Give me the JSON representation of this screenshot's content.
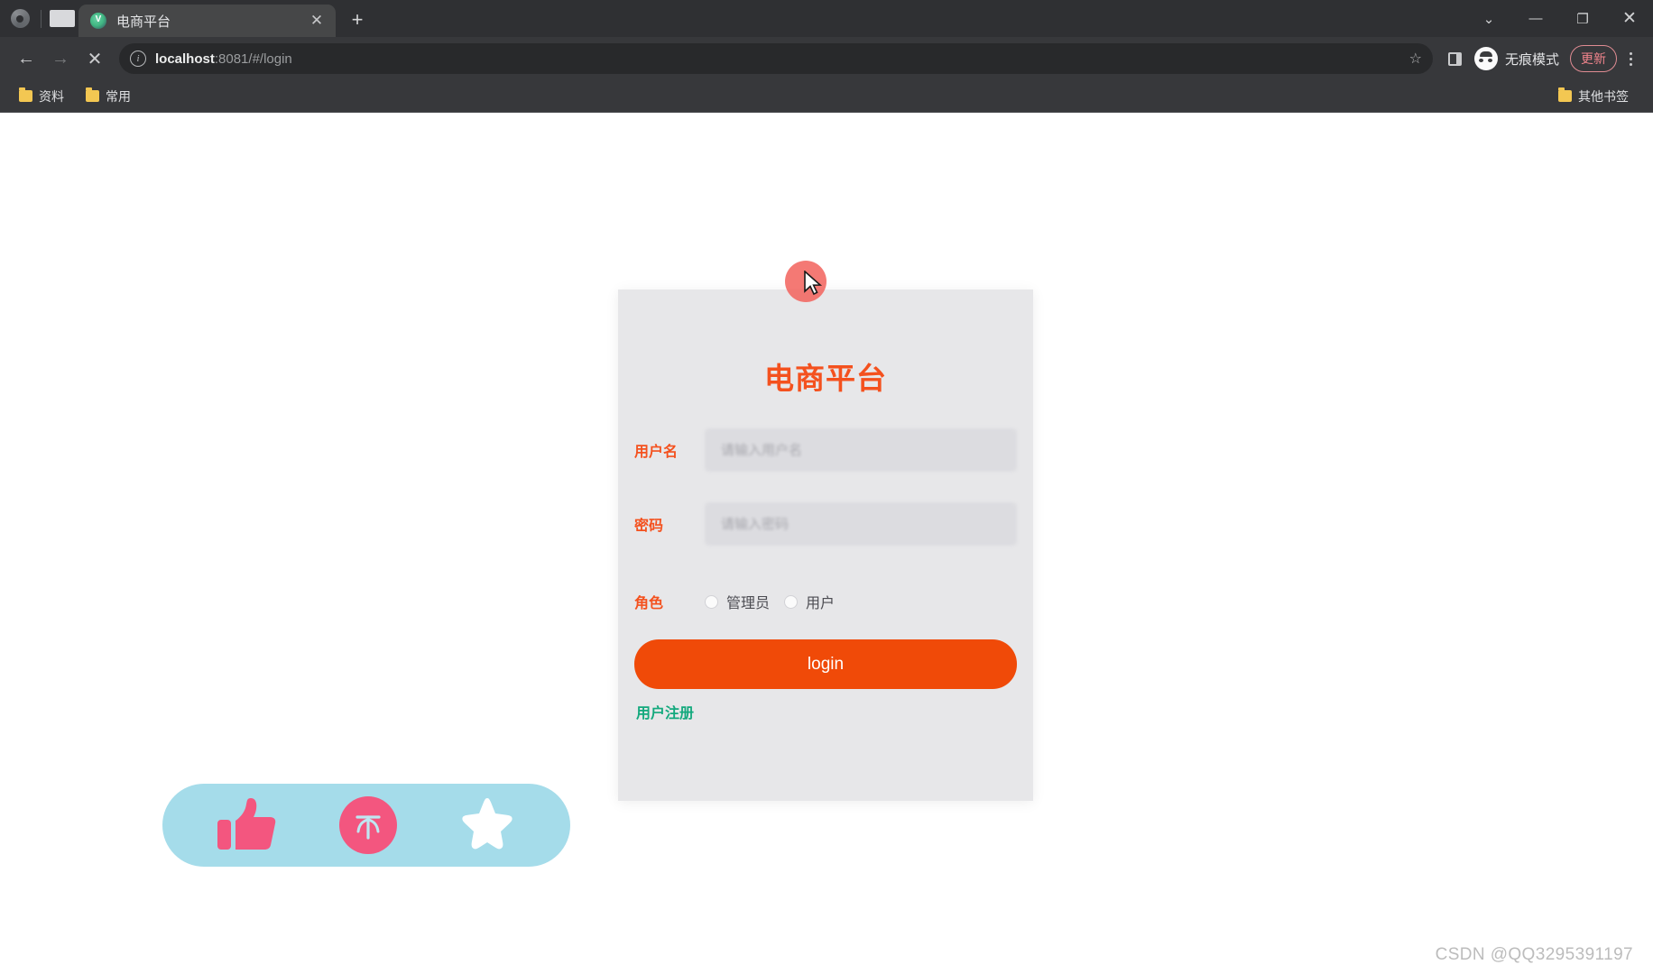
{
  "browser": {
    "tab": {
      "title": "电商平台",
      "favicon": "vue-logo-icon",
      "favicon_glyph": "V",
      "close_label": "✕"
    },
    "new_tab_label": "+",
    "window_controls": {
      "tab_search": "⌄",
      "minimize": "—",
      "maximize": "❐",
      "close": "✕"
    },
    "toolbar": {
      "back": "←",
      "forward": "→",
      "stop": "✕",
      "info_icon": "i",
      "url_host": "localhost",
      "url_rest": ":8081/#/login",
      "bookmark_star": "☆",
      "side_panel": "side-panel-icon",
      "incognito_label": "无痕模式",
      "update_label": "更新",
      "menu": "kebab-menu-icon"
    },
    "bookmarks": {
      "items": [
        {
          "label": "资料"
        },
        {
          "label": "常用"
        }
      ],
      "other": {
        "label": "其他书签"
      }
    }
  },
  "page": {
    "card": {
      "title": "电商平台",
      "fields": [
        {
          "label": "用户名",
          "value": "",
          "placeholder": "请输入用户名"
        },
        {
          "label": "密码",
          "value": "",
          "placeholder": "请输入密码"
        }
      ],
      "role": {
        "label": "角色",
        "options": [
          {
            "label": "管理员",
            "selected": false
          },
          {
            "label": "用户",
            "selected": false
          }
        ]
      },
      "login_button": "login",
      "register_link": "用户注册"
    },
    "sticker": {
      "icons": [
        "thumbs-up-icon",
        "pink-circle-char-icon",
        "star-icon"
      ],
      "circle_char": "不"
    },
    "watermark": "CSDN @QQ3295391197"
  },
  "colors": {
    "brand_orange": "#f4511e",
    "login_button": "#f04a08",
    "register_green": "#13a97d",
    "card_bg": "#e7e7e9",
    "input_bg": "#dcdce0",
    "sticker_blue": "#a5dcea",
    "sticker_pink": "#f3567f",
    "cursor_halo": "#f2615c",
    "update_pill": "#f0848c"
  }
}
